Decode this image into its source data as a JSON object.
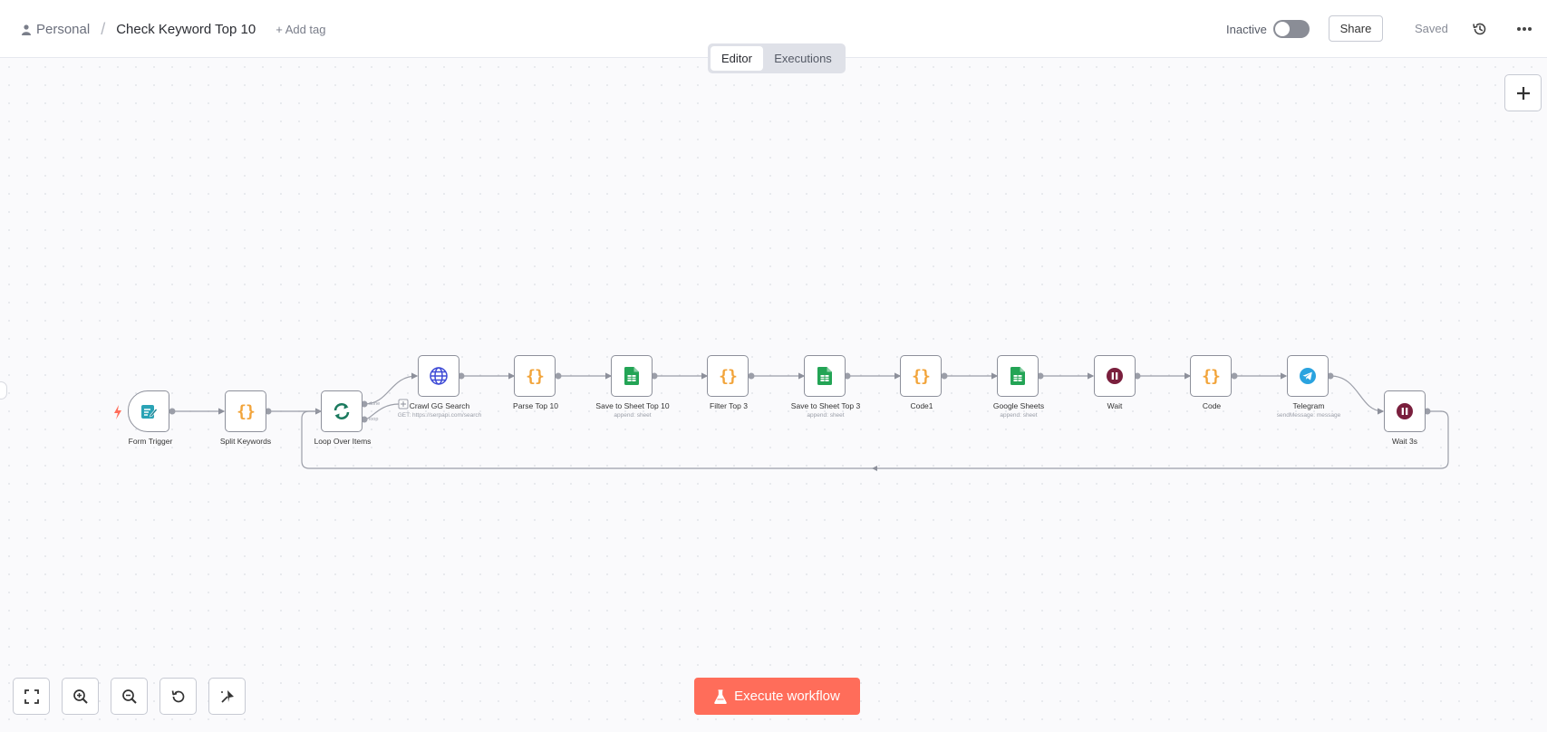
{
  "header": {
    "project": "Personal",
    "separator": "/",
    "workflow_title": "Check Keyword Top 10",
    "add_tag": "+ Add tag",
    "status_label": "Inactive",
    "share_label": "Share",
    "saved_label": "Saved",
    "history_icon": "history-icon",
    "more_icon": "more-icon"
  },
  "tabs": {
    "editor": "Editor",
    "executions": "Executions",
    "active": "Editor"
  },
  "nodes": [
    {
      "label": "Form Trigger",
      "subtitle": "",
      "icon": "form-trigger-icon"
    },
    {
      "label": "Split Keywords",
      "subtitle": "",
      "icon": "code-icon"
    },
    {
      "label": "Loop Over Items",
      "subtitle": "",
      "icon": "loop-icon"
    },
    {
      "label": "Crawl GG Search",
      "subtitle": "GET: https://serpapi.com/search",
      "icon": "globe-icon"
    },
    {
      "label": "Parse Top 10",
      "subtitle": "",
      "icon": "code-icon"
    },
    {
      "label": "Save to Sheet Top 10",
      "subtitle": "append: sheet",
      "icon": "google-sheets-icon"
    },
    {
      "label": "Filter Top 3",
      "subtitle": "",
      "icon": "code-icon"
    },
    {
      "label": "Save to Sheet Top 3",
      "subtitle": "append: sheet",
      "icon": "google-sheets-icon"
    },
    {
      "label": "Code1",
      "subtitle": "",
      "icon": "code-icon"
    },
    {
      "label": "Google Sheets",
      "subtitle": "append: sheet",
      "icon": "google-sheets-icon"
    },
    {
      "label": "Wait",
      "subtitle": "",
      "icon": "wait-icon"
    },
    {
      "label": "Code",
      "subtitle": "",
      "icon": "code-icon"
    },
    {
      "label": "Telegram",
      "subtitle": "sendMessage: message",
      "icon": "telegram-icon"
    },
    {
      "label": "Wait 3s",
      "subtitle": "",
      "icon": "wait-icon"
    }
  ],
  "loop_ports": {
    "done": "done",
    "loop": "loop"
  },
  "code_glyph": "{}",
  "execute_button": "Execute workflow",
  "controls": [
    "fit-view-icon",
    "zoom-in-icon",
    "zoom-out-icon",
    "reset-zoom-icon",
    "tidy-up-icon"
  ],
  "colors": {
    "accent": "#ff6d5a",
    "code": "#f2a43a",
    "sheets": "#23a455",
    "wait": "#7a1f3d",
    "telegram": "#2aa3df",
    "loop": "#1b7a5e",
    "globe": "#3e4bd6"
  }
}
